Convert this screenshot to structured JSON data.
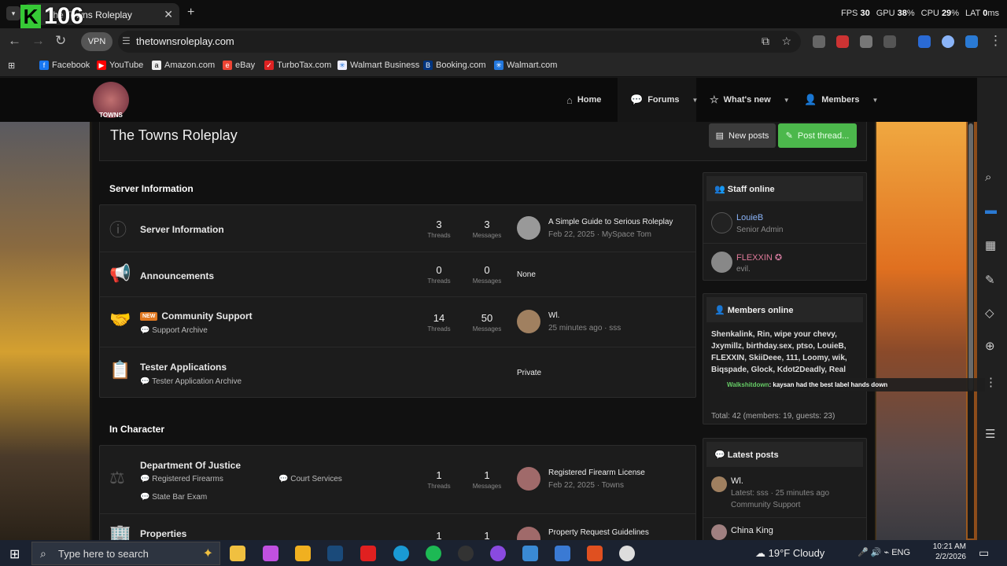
{
  "overlay": {
    "counter": "106"
  },
  "perf": {
    "fps_label": "FPS",
    "fps": "30",
    "gpu_label": "GPU",
    "gpu": "38",
    "cpu_label": "CPU",
    "cpu": "29",
    "lat_label": "LAT",
    "lat": "0"
  },
  "tab": {
    "title": "The Towns Roleplay"
  },
  "browser": {
    "vpn": "VPN",
    "url": "thetownsroleplay.com"
  },
  "bookmarks": [
    "Facebook",
    "YouTube",
    "Amazon.com",
    "eBay",
    "TurboTax.com",
    "Walmart Business",
    "Booking.com",
    "Walmart.com"
  ],
  "site": {
    "logo_text": "TOWNS",
    "nav": {
      "home": "Home",
      "forums": "Forums",
      "whats_new": "What's new",
      "members": "Members"
    },
    "page_title": "The Towns Roleplay",
    "new_posts": "New posts",
    "post_thread": "Post thread..."
  },
  "categories": {
    "server_info": "Server Information",
    "in_character": "In Character"
  },
  "nodes": {
    "server_information": {
      "title": "Server Information",
      "threads": "3",
      "messages": "3",
      "last_title": "A Simple Guide to Serious Roleplay",
      "last_meta": "Feb 22, 2025 · MySpace Tom"
    },
    "announcements": {
      "title": "Announcements",
      "threads": "0",
      "messages": "0",
      "last_title": "None"
    },
    "community_support": {
      "badge": "NEW",
      "title": "Community Support",
      "sub": "Support Archive",
      "threads": "14",
      "messages": "50",
      "last_title": "Wl.",
      "last_meta": "25 minutes ago · sss"
    },
    "tester_applications": {
      "title": "Tester Applications",
      "sub": "Tester Application Archive",
      "last_title": "Private"
    },
    "doj": {
      "title": "Department Of Justice",
      "sub1": "Registered Firearms",
      "sub2": "Court Services",
      "sub3": "State Bar Exam",
      "threads": "1",
      "messages": "1",
      "last_title": "Registered Firearm License",
      "last_meta": "Feb 22, 2025 · Towns"
    },
    "properties": {
      "title": "Properties",
      "threads": "1",
      "messages": "1",
      "last_title": "Property Request Guidelines"
    }
  },
  "stat_labels": {
    "threads": "Threads",
    "messages": "Messages"
  },
  "staff_online": {
    "title": "Staff online",
    "members": [
      {
        "name": "LouieB",
        "role": "Senior Admin"
      },
      {
        "name": "FLEXXIN",
        "role": "evil."
      }
    ]
  },
  "members_online": {
    "title": "Members online",
    "names": "Shenkalink, Rin, wipe your chevy, Jxymillz, birthday.sex, ptso, LouieB, FLEXXIN, SkiiDeee, 111, Loomy, wik, Biqspade, Glock, Kdot2Deadly, Real",
    "total": "Total: 42 (members: 19, guests: 23)"
  },
  "chat_overlay": {
    "user": "Walkshitdown",
    "message": ": kaysan had the best label hands down"
  },
  "latest_posts": {
    "title": "Latest posts",
    "items": [
      {
        "title": "Wl.",
        "meta": "Latest: sss · 25 minutes ago",
        "forum": "Community Support"
      },
      {
        "title": "China King"
      }
    ]
  },
  "taskbar": {
    "search": "Type here to search",
    "weather": "19°F Cloudy",
    "lang": "ENG",
    "time": "10:21 AM",
    "date": "2/2/2026"
  }
}
